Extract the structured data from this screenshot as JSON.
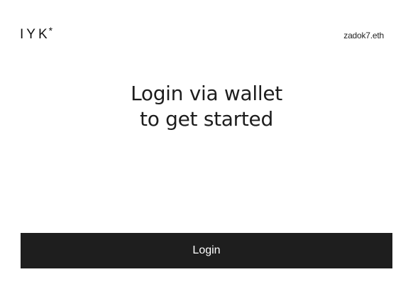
{
  "header": {
    "logo_text": "IYK",
    "logo_mark": "*",
    "account_name": "zadok7.eth"
  },
  "hero": {
    "line1": "Login via wallet",
    "line2": "to get started"
  },
  "actions": {
    "login_label": "Login"
  },
  "colors": {
    "background": "#ffffff",
    "button_bg": "#1e1e1e",
    "button_text": "#ffffff",
    "text": "#1d1d1d"
  }
}
